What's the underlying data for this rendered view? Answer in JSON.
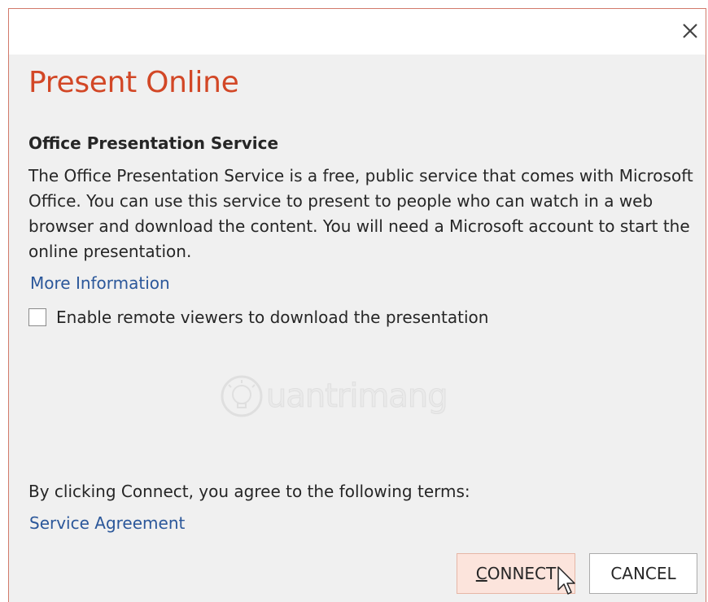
{
  "dialog": {
    "title": "Present Online",
    "close_icon": "close-icon",
    "section_heading": "Office Presentation Service",
    "description": "The Office Presentation Service is a free, public service that comes with Microsoft Office. You can use this service to present to people who can watch in a web browser and download the content. You will need a Microsoft account to start the online presentation.",
    "more_info_link": "More Information",
    "checkbox": {
      "label": "Enable remote viewers to download the presentation",
      "checked": false
    },
    "terms_text": "By clicking Connect, you agree to the following terms:",
    "service_agreement_link": "Service Agreement",
    "buttons": {
      "connect": "CONNECT",
      "cancel": "CANCEL"
    }
  },
  "watermark": {
    "text": "uantrimang"
  },
  "colors": {
    "title": "#d24726",
    "link": "#2b579a",
    "background": "#f0f0f0",
    "connect_button_bg": "#fce4dc"
  }
}
